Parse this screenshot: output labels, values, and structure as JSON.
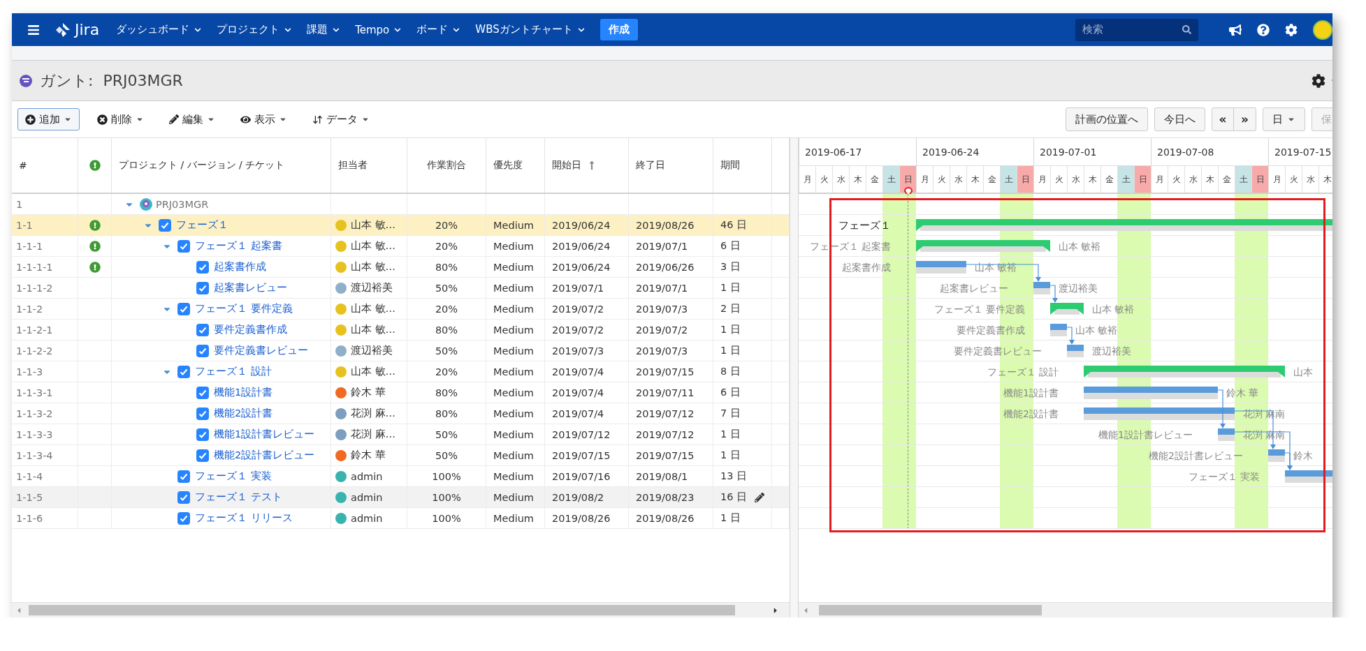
{
  "nav": {
    "logo": "Jira",
    "menu": [
      "ダッシュボード",
      "プロジェクト",
      "課題",
      "Tempo",
      "ボード",
      "WBSガントチャート"
    ],
    "create": "作成",
    "search_placeholder": "検索"
  },
  "title": "ガント:  PRJ03MGR",
  "toolbar": {
    "actions": [
      {
        "label": "追加",
        "kind": "add",
        "selected": true
      },
      {
        "label": "削除",
        "kind": "delete",
        "selected": false
      },
      {
        "label": "編集",
        "kind": "edit",
        "selected": false
      },
      {
        "label": "表示",
        "kind": "view",
        "selected": false
      },
      {
        "label": "データ",
        "kind": "data",
        "selected": false
      }
    ],
    "buttons": [
      "計画の位置へ",
      "今日へ"
    ],
    "paging": [
      "«",
      "»"
    ],
    "scale": "日",
    "save": {
      "label": "保",
      "disabled": true
    }
  },
  "table": {
    "columns": [
      {
        "kind": "text",
        "label": "#",
        "sorted": false
      },
      {
        "kind": "alert"
      },
      {
        "kind": "text",
        "label": "プロジェクト / バージョン / チケット",
        "sorted": false
      },
      {
        "kind": "text",
        "label": "担当者",
        "sorted": false
      },
      {
        "kind": "text",
        "label": "作業割合",
        "sorted": false
      },
      {
        "kind": "text",
        "label": "優先度",
        "sorted": false
      },
      {
        "kind": "text",
        "label": "開始日",
        "sorted": true
      },
      {
        "kind": "text",
        "label": "終了日",
        "sorted": false
      },
      {
        "kind": "text",
        "label": "期間",
        "sorted": false
      },
      {
        "kind": "cut"
      }
    ],
    "rows": [
      {
        "id": "1",
        "kind": "project",
        "name": "PRJ03MGR",
        "alert": false,
        "expanded": true,
        "selected": false,
        "hover": false,
        "children": [
          {
            "id": "1-1",
            "kind": "task",
            "name": "フェーズ１",
            "alert": true,
            "expanded": true,
            "checked": true,
            "selected": true,
            "hover": false,
            "assignee": {
              "name": "山本 敏…",
              "color": "#e6c21e"
            },
            "ratio": "20%",
            "priority": "Medium",
            "start": "2019/06/24",
            "end": "2019/08/26",
            "duration": "46 日",
            "bar": {
              "kind": "summary",
              "label": "フェーズ１"
            },
            "children": [
              {
                "id": "1-1-1",
                "kind": "task",
                "name": "フェーズ１ 起案書",
                "alert": true,
                "expanded": true,
                "checked": true,
                "selected": false,
                "hover": false,
                "assignee": {
                  "name": "山本 敏…",
                  "color": "#e6c21e"
                },
                "ratio": "20%",
                "priority": "Medium",
                "start": "2019/06/24",
                "end": "2019/07/1",
                "duration": "6 日",
                "bar": {
                  "kind": "summary",
                  "label": "フェーズ１ 起案書",
                  "assignee": "山本 敏裕"
                },
                "children": [
                  {
                    "id": "1-1-1-1",
                    "kind": "task",
                    "name": "起案書作成",
                    "alert": true,
                    "checked": true,
                    "selected": false,
                    "hover": false,
                    "assignee": {
                      "name": "山本 敏…",
                      "color": "#e6c21e"
                    },
                    "ratio": "80%",
                    "priority": "Medium",
                    "start": "2019/06/24",
                    "end": "2019/06/26",
                    "duration": "3 日",
                    "bar": {
                      "kind": "task",
                      "label": "起案書作成",
                      "assignee": "山本 敏裕"
                    }
                  },
                  {
                    "id": "1-1-1-2",
                    "kind": "task",
                    "name": "起案書レビュー",
                    "alert": false,
                    "checked": true,
                    "selected": false,
                    "hover": false,
                    "assignee": {
                      "name": "渡辺裕美",
                      "color": "#8fb0c8"
                    },
                    "ratio": "50%",
                    "priority": "Medium",
                    "start": "2019/07/1",
                    "end": "2019/07/1",
                    "duration": "1 日",
                    "bar": {
                      "kind": "task",
                      "label": "起案書レビュー",
                      "assignee": "渡辺裕美",
                      "from_previous": true
                    }
                  }
                ]
              },
              {
                "id": "1-1-2",
                "kind": "task",
                "name": "フェーズ１ 要件定義",
                "alert": false,
                "expanded": true,
                "checked": true,
                "selected": false,
                "hover": false,
                "assignee": {
                  "name": "山本 敏…",
                  "color": "#e6c21e"
                },
                "ratio": "20%",
                "priority": "Medium",
                "start": "2019/07/2",
                "end": "2019/07/3",
                "duration": "2 日",
                "bar": {
                  "kind": "summary",
                  "label": "フェーズ１ 要件定義",
                  "assignee": "山本 敏裕",
                  "from_previous": true
                },
                "children": [
                  {
                    "id": "1-1-2-1",
                    "kind": "task",
                    "name": "要件定義書作成",
                    "alert": false,
                    "checked": true,
                    "selected": false,
                    "hover": false,
                    "assignee": {
                      "name": "山本 敏…",
                      "color": "#e6c21e"
                    },
                    "ratio": "80%",
                    "priority": "Medium",
                    "start": "2019/07/2",
                    "end": "2019/07/2",
                    "duration": "1 日",
                    "bar": {
                      "kind": "task",
                      "label": "要件定義書作成",
                      "assignee": "山本 敏裕"
                    }
                  },
                  {
                    "id": "1-1-2-2",
                    "kind": "task",
                    "name": "要件定義書レビュー",
                    "alert": false,
                    "checked": true,
                    "selected": false,
                    "hover": false,
                    "assignee": {
                      "name": "渡辺裕美",
                      "color": "#8fb0c8"
                    },
                    "ratio": "50%",
                    "priority": "Medium",
                    "start": "2019/07/3",
                    "end": "2019/07/3",
                    "duration": "1 日",
                    "bar": {
                      "kind": "task",
                      "label": "要件定義書レビュー",
                      "assignee": "渡辺裕美",
                      "from_previous": true
                    }
                  }
                ]
              },
              {
                "id": "1-1-3",
                "kind": "task",
                "name": "フェーズ１ 設計",
                "alert": false,
                "expanded": true,
                "checked": true,
                "selected": false,
                "hover": false,
                "assignee": {
                  "name": "山本 敏…",
                  "color": "#e6c21e"
                },
                "ratio": "20%",
                "priority": "Medium",
                "start": "2019/07/4",
                "end": "2019/07/15",
                "duration": "8 日",
                "bar": {
                  "kind": "summary",
                  "label": "フェーズ１ 設計",
                  "assignee": "山本"
                },
                "children": [
                  {
                    "id": "1-1-3-1",
                    "kind": "task",
                    "name": "機能1設計書",
                    "alert": false,
                    "checked": true,
                    "selected": false,
                    "hover": false,
                    "assignee": {
                      "name": "鈴木 華",
                      "color": "#f26a21"
                    },
                    "ratio": "80%",
                    "priority": "Medium",
                    "start": "2019/07/4",
                    "end": "2019/07/11",
                    "duration": "6 日",
                    "bar": {
                      "kind": "task",
                      "label": "機能1設計書",
                      "assignee": "鈴木 華"
                    }
                  },
                  {
                    "id": "1-1-3-2",
                    "kind": "task",
                    "name": "機能2設計書",
                    "alert": false,
                    "checked": true,
                    "selected": false,
                    "hover": false,
                    "assignee": {
                      "name": "花渕 麻…",
                      "color": "#7d9fbf"
                    },
                    "ratio": "80%",
                    "priority": "Medium",
                    "start": "2019/07/4",
                    "end": "2019/07/12",
                    "duration": "7 日",
                    "bar": {
                      "kind": "task",
                      "label": "機能2設計書",
                      "assignee": "花渕 麻南"
                    }
                  },
                  {
                    "id": "1-1-3-3",
                    "kind": "task",
                    "name": "機能1設計書レビュー",
                    "alert": false,
                    "checked": true,
                    "selected": false,
                    "hover": false,
                    "assignee": {
                      "name": "花渕 麻…",
                      "color": "#7d9fbf"
                    },
                    "ratio": "50%",
                    "priority": "Medium",
                    "start": "2019/07/12",
                    "end": "2019/07/12",
                    "duration": "1 日",
                    "bar": {
                      "kind": "task",
                      "label": "機能1設計書レビュー",
                      "assignee": "花渕 麻南",
                      "from_second_previous": true
                    }
                  },
                  {
                    "id": "1-1-3-4",
                    "kind": "task",
                    "name": "機能2設計書レビュー",
                    "alert": false,
                    "checked": true,
                    "selected": false,
                    "hover": false,
                    "assignee": {
                      "name": "鈴木 華",
                      "color": "#f26a21"
                    },
                    "ratio": "50%",
                    "priority": "Medium",
                    "start": "2019/07/15",
                    "end": "2019/07/15",
                    "duration": "1 日",
                    "bar": {
                      "kind": "task",
                      "label": "機能2設計書レビュー",
                      "assignee": "鈴木",
                      "from_second_previous": true
                    }
                  }
                ]
              },
              {
                "id": "1-1-4",
                "kind": "task",
                "name": "フェーズ１ 実装",
                "alert": false,
                "checked": true,
                "selected": false,
                "hover": false,
                "assignee": {
                  "name": "admin",
                  "color": "#39b3ae"
                },
                "ratio": "100%",
                "priority": "Medium",
                "start": "2019/07/16",
                "end": "2019/08/1",
                "duration": "13 日",
                "bar": {
                  "kind": "task",
                  "label": "フェーズ１ 実装",
                  "from_previous": true,
                  "from_second_previous": true
                }
              },
              {
                "id": "1-1-5",
                "kind": "task",
                "name": "フェーズ１ テスト",
                "alert": false,
                "checked": true,
                "selected": false,
                "hover": true,
                "assignee": {
                  "name": "admin",
                  "color": "#39b3ae"
                },
                "ratio": "100%",
                "priority": "Medium",
                "start": "2019/08/2",
                "end": "2019/08/23",
                "duration": "16 日"
              },
              {
                "id": "1-1-6",
                "kind": "task",
                "name": "フェーズ１ リリース",
                "alert": false,
                "checked": true,
                "selected": false,
                "hover": false,
                "assignee": {
                  "name": "admin",
                  "color": "#39b3ae"
                },
                "ratio": "100%",
                "priority": "Medium",
                "start": "2019/08/26",
                "end": "2019/08/26",
                "duration": "1 日"
              }
            ]
          }
        ]
      }
    ]
  },
  "gantt": {
    "weeks": [
      "2019-06-17",
      "2019-06-24",
      "2019-07-01",
      "2019-07-08",
      "2019-07-15"
    ],
    "days": [
      {
        "label": "月",
        "kind": "weekday",
        "today": false
      },
      {
        "label": "火",
        "kind": "weekday",
        "today": false
      },
      {
        "label": "水",
        "kind": "weekday",
        "today": false
      },
      {
        "label": "木",
        "kind": "weekday",
        "today": false
      },
      {
        "label": "金",
        "kind": "weekday",
        "today": false
      },
      {
        "label": "土",
        "kind": "sat",
        "today": false
      },
      {
        "label": "日",
        "kind": "sun",
        "today": true
      },
      {
        "label": "月",
        "kind": "weekday",
        "today": false
      },
      {
        "label": "火",
        "kind": "weekday",
        "today": false
      },
      {
        "label": "水",
        "kind": "weekday",
        "today": false
      },
      {
        "label": "木",
        "kind": "weekday",
        "today": false
      },
      {
        "label": "金",
        "kind": "weekday",
        "today": false
      },
      {
        "label": "土",
        "kind": "sat",
        "today": false
      },
      {
        "label": "日",
        "kind": "sun",
        "today": false
      },
      {
        "label": "月",
        "kind": "weekday",
        "today": false
      },
      {
        "label": "火",
        "kind": "weekday",
        "today": false
      },
      {
        "label": "水",
        "kind": "weekday",
        "today": false
      },
      {
        "label": "木",
        "kind": "weekday",
        "today": false
      },
      {
        "label": "金",
        "kind": "weekday",
        "today": false
      },
      {
        "label": "土",
        "kind": "sat",
        "today": false
      },
      {
        "label": "日",
        "kind": "sun",
        "today": false
      },
      {
        "label": "月",
        "kind": "weekday",
        "today": false
      },
      {
        "label": "火",
        "kind": "weekday",
        "today": false
      },
      {
        "label": "水",
        "kind": "weekday",
        "today": false
      },
      {
        "label": "木",
        "kind": "weekday",
        "today": false
      },
      {
        "label": "金",
        "kind": "weekday",
        "today": false
      },
      {
        "label": "土",
        "kind": "sat",
        "today": false
      },
      {
        "label": "日",
        "kind": "sun",
        "today": false
      },
      {
        "label": "月",
        "kind": "weekday",
        "today": false
      },
      {
        "label": "火",
        "kind": "weekday",
        "today": false
      },
      {
        "label": "水",
        "kind": "weekday",
        "today": false
      },
      {
        "label": "木",
        "kind": "weekday",
        "today": false
      }
    ]
  }
}
